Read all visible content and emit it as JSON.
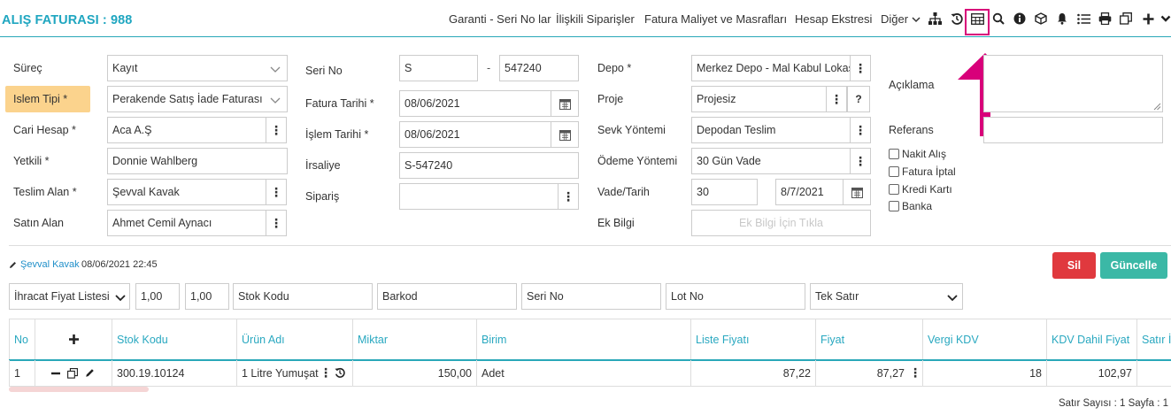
{
  "header": {
    "title": "ALIŞ FATURASI : 988",
    "links": [
      "Garanti - Seri No lar",
      "İlişkili Siparişler",
      "Fatura Maliyet ve Masrafları",
      "Hesap Ekstresi",
      "Diğer"
    ],
    "icons": [
      "sitemap-icon",
      "history-icon",
      "table-icon",
      "search-icon",
      "info-icon",
      "cube-icon",
      "bell-icon",
      "list-icon",
      "print-icon",
      "copy-icon",
      "plus-icon",
      "chevron-down-icon"
    ]
  },
  "form": {
    "surec": {
      "label": "Süreç",
      "value": "Kayıt"
    },
    "islem_tipi": {
      "label": "Islem Tipi *",
      "value": "Perakende Satış İade Faturası"
    },
    "cari_hesap": {
      "label": "Cari Hesap *",
      "value": "Aca A.Ş"
    },
    "yetkili": {
      "label": "Yetkili *",
      "value": "Donnie Wahlberg"
    },
    "teslim_alan": {
      "label": "Teslim Alan *",
      "value": "Şevval Kavak"
    },
    "satin_alan": {
      "label": "Satın Alan",
      "value": "Ahmet Cemil Aynacı"
    },
    "seri_no": {
      "label": "Seri No",
      "prefix": "S",
      "separator": "-",
      "number": "547240"
    },
    "fatura_tarihi": {
      "label": "Fatura Tarihi *",
      "value": "08/06/2021"
    },
    "islem_tarihi": {
      "label": "İşlem Tarihi *",
      "value": "08/06/2021"
    },
    "irsaliye": {
      "label": "İrsaliye",
      "value": "S-547240"
    },
    "siparis": {
      "label": "Sipariş",
      "value": ""
    },
    "depo": {
      "label": "Depo *",
      "value": "Merkez Depo - Mal Kabul Lokas"
    },
    "proje": {
      "label": "Proje",
      "value": "Projesiz",
      "help": "?"
    },
    "sevk_yontemi": {
      "label": "Sevk Yöntemi",
      "value": "Depodan Teslim"
    },
    "odeme_yontemi": {
      "label": "Ödeme Yöntemi",
      "value": "30 Gün Vade"
    },
    "vade_tarih": {
      "label": "Vade/Tarih",
      "days": "30",
      "date": "8/7/2021"
    },
    "ek_bilgi": {
      "label": "Ek Bilgi",
      "button": "Ek Bilgi İçin Tıkla"
    },
    "aciklama": {
      "label": "Açıklama",
      "value": ""
    },
    "referans": {
      "label": "Referans",
      "value": ""
    },
    "checkboxes": [
      "Nakit Alış",
      "Fatura İptal",
      "Kredi Kartı",
      "Banka"
    ]
  },
  "audit": {
    "user": "Şevval Kavak",
    "datetime": "08/06/2021 22:45"
  },
  "actions": {
    "delete": "Sil",
    "update": "Güncelle"
  },
  "entry_bar": {
    "price_list": "İhracat Fiyat Listesi",
    "qty1": "1,00",
    "qty2": "1,00",
    "stok_kodu_ph": "Stok Kodu",
    "barkod_ph": "Barkod",
    "seri_no_ph": "Seri No",
    "lot_no_ph": "Lot No",
    "mode": "Tek Satır"
  },
  "table": {
    "columns": [
      "No",
      "+",
      "Stok Kodu",
      "Ürün Adı",
      "Miktar",
      "Birim",
      "Liste Fiyatı",
      "Fiyat",
      "Vergi KDV",
      "KDV Dahil Fiyat",
      "Satır İ"
    ],
    "rows": [
      {
        "no": "1",
        "stok_kodu": "300.19.10124",
        "urun_adi": "1 Litre Yumuşat",
        "miktar": "150,00",
        "birim": "Adet",
        "liste_fiyati": "87,22",
        "fiyat": "87,27",
        "vergi_kdv": "18",
        "kdv_dahil": "102,97"
      }
    ]
  },
  "footer": {
    "summary": "Satır Sayısı : 1 Sayfa : 1"
  },
  "colors": {
    "accent": "#1fa6c0",
    "highlight": "#d8007a",
    "delete": "#e0393e",
    "update": "#3bb8a6",
    "label_highlight": "#fbd38d"
  }
}
